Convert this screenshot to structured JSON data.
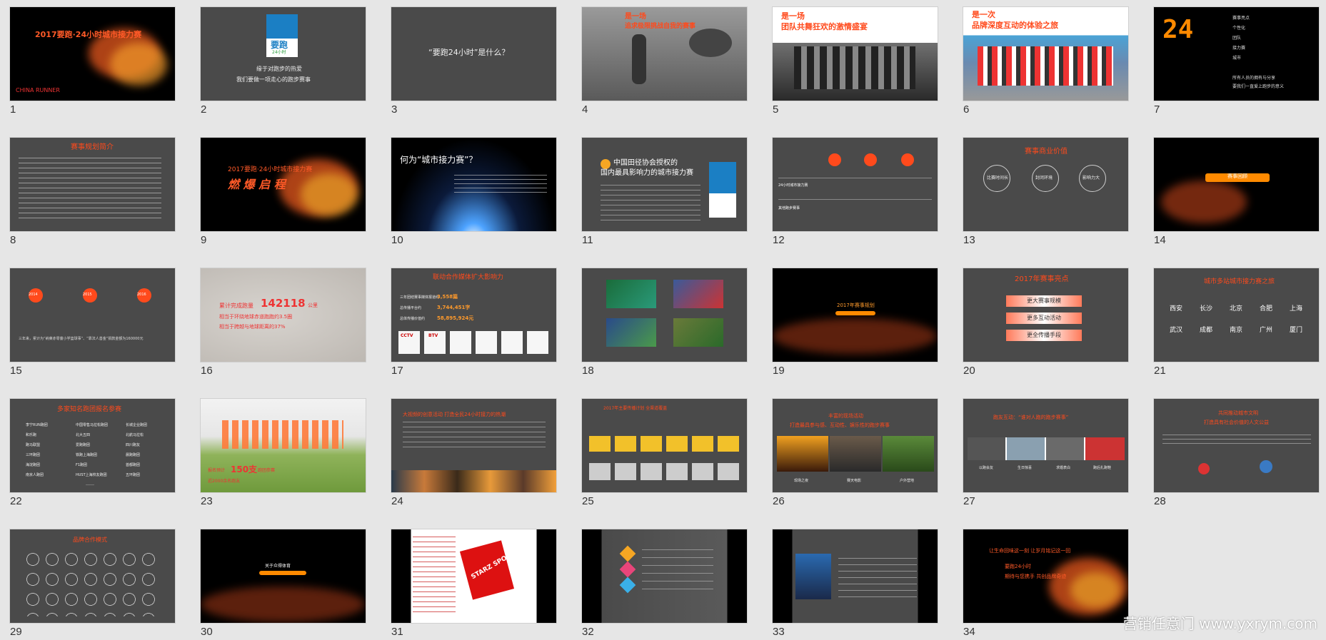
{
  "watermark": "营销任意门 www.yxrym.com",
  "slides": [
    {
      "n": "1",
      "title": "2017要跑·24小时城市接力赛",
      "sub": "CHINA RUNNER"
    },
    {
      "n": "2",
      "l1": "缘于对跑步的热爱",
      "l2": "我们要做一项走心的跑步赛事",
      "logo": "要跑",
      "logo_sub": "24小时"
    },
    {
      "n": "3",
      "title": "“要跑24小时”是什么？"
    },
    {
      "n": "4",
      "title": "是一场",
      "sub": "追求极限挑战自我的赛事"
    },
    {
      "n": "5",
      "title": "是一场",
      "sub": "团队共舞狂欢的激情盛宴"
    },
    {
      "n": "6",
      "title": "是一次",
      "sub": "品牌深度互动的体验之旅"
    },
    {
      "n": "7",
      "big": "24",
      "items": [
        "赛事亮点",
        "个性化",
        "团队",
        "接力赛",
        "城市"
      ],
      "foot1": "所有人员的拥有与分享",
      "foot2": "要我们一直爱上跑步的意义"
    },
    {
      "n": "8",
      "title": "赛事规划简介"
    },
    {
      "n": "9",
      "title": "2017要跑·24小时城市接力赛",
      "sub": "燃 爆 启 程"
    },
    {
      "n": "10",
      "title": "何为“城市接力赛”？"
    },
    {
      "n": "11",
      "l1": "中国田径协会授权的",
      "l2": "国内最具影响力的城市接力赛"
    },
    {
      "n": "12",
      "r1": "24小时城市接力赛",
      "r2": "其他跑步赛事"
    },
    {
      "n": "13",
      "title": "赛事商业价值",
      "c1": "比赛时间长",
      "c2": "封闭环境",
      "c3": "影响力大"
    },
    {
      "n": "14",
      "btn": "赛事回顾"
    },
    {
      "n": "15",
      "y1": "2014",
      "y2": "2015",
      "y3": "2016",
      "foot": "三年来，累计为“纳莱赤零童小学篮球事”、“靠法人善金”捐款金额为160000元"
    },
    {
      "n": "16",
      "l1": "累计完成跑量",
      "num": "142118",
      "unit": "公里",
      "l2": "相当于环绕地球赤道跑跑约3.5圈",
      "l3": "相当于跨越与地球距离的37%"
    },
    {
      "n": "17",
      "title": "联动合作媒体扩大影响力",
      "s1": "三年团结赛事媒体报道约",
      "v1": "3,558篇",
      "s2": "总传播平台约",
      "v2": "3,744,451字",
      "s3": "总体传播价值约",
      "v3": "58,895,924元",
      "logos": [
        "CCTV",
        "BTV",
        "",
        "",
        "",
        ""
      ]
    },
    {
      "n": "18"
    },
    {
      "n": "19",
      "btn": "2017年赛事规划"
    },
    {
      "n": "20",
      "title": "2017年赛事亮点",
      "b1": "更大赛事规模",
      "b2": "更多互动活动",
      "b3": "更全传播手段"
    },
    {
      "n": "21",
      "title": "城市多站城市接力赛之旅",
      "cities1": [
        "西安",
        "长沙",
        "北京",
        "合肥",
        "上海"
      ],
      "cities2": [
        "武汉",
        "成都",
        "南京",
        "广州",
        "厦门"
      ]
    },
    {
      "n": "22",
      "title": "多家知名跑团报名参赛",
      "teams": [
        "李宁RUN跑团",
        "中国零售马拉松跑团",
        "长城企业跑团",
        "和乐跑",
        "北大五四",
        "北航马拉松",
        "跑马联盟",
        "爱跑跑团",
        "四川跑友",
        "三环跑团",
        "铁跑上海跑团",
        "晨跑跑团",
        "海淀跑团",
        "F1跑团",
        "首都跑团",
        "南京人跑团",
        "HUST上海校友跑团",
        "五环跑团"
      ],
      "more": "……"
    },
    {
      "n": "23",
      "l1": "报名预计",
      "num": "150支",
      "l2": "跑团参赛",
      "l3": "近2000余名跑友"
    },
    {
      "n": "24",
      "title": "大视频的创意活动 打造全民24小时接力的热潮"
    },
    {
      "n": "25",
      "title": "2017年主要传播计划 全渠道覆盖"
    },
    {
      "n": "26",
      "title": "丰富的现场活动",
      "sub": "打造最具参与感、互动性、娱乐性的跑步赛事",
      "c1": "现场之夜",
      "c2": "赛天电影",
      "c3": "户外营地"
    },
    {
      "n": "27",
      "title": "跑友互动：“谁对人跑的跑步赛事”",
      "c1": "以跑会友",
      "c2": "生日惊喜",
      "c3": "求婚表白",
      "c4": "跑后扎跑鞋"
    },
    {
      "n": "28",
      "title": "共同推动城市文明",
      "sub": "打造具有社会价值的人文公益"
    },
    {
      "n": "29",
      "title": "品牌合作模式"
    },
    {
      "n": "30",
      "btn": "关于众得体育"
    },
    {
      "n": "31",
      "logo": "STARZ SPORTS"
    },
    {
      "n": "32"
    },
    {
      "n": "33"
    },
    {
      "n": "34",
      "l1": "让生命回味这一刻 让岁月铭记这一回",
      "l2": "要跑24小时",
      "l3": "期待与您携手 共创品牌奇迹"
    }
  ]
}
